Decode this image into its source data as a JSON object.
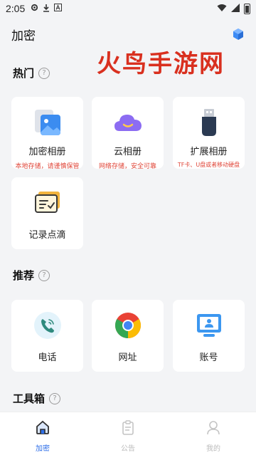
{
  "status_bar": {
    "time": "2:05"
  },
  "header": {
    "title": "加密"
  },
  "watermark": "火鸟手游网",
  "sections": {
    "hot": "热门",
    "recommend": "推荐",
    "tools": "工具箱",
    "help": "?"
  },
  "hot_cards": [
    {
      "label": "加密相册",
      "sub": "本地存储，请谨慎保管",
      "icon": "photo-album-icon"
    },
    {
      "label": "云相册",
      "sub": "网络存储，安全可靠",
      "icon": "cloud-icon"
    },
    {
      "label": "扩展相册",
      "sub": "TF卡、U盘或者移动硬盘",
      "icon": "usb-drive-icon"
    },
    {
      "label": "记录点滴",
      "icon": "notes-icon"
    }
  ],
  "recommend_cards": [
    {
      "label": "电话",
      "icon": "phone-icon"
    },
    {
      "label": "网址",
      "icon": "browser-icon"
    },
    {
      "label": "账号",
      "icon": "account-icon"
    }
  ],
  "bottom_nav": [
    {
      "label": "加密",
      "icon": "home-icon"
    },
    {
      "label": "公告",
      "icon": "notice-icon"
    },
    {
      "label": "我的",
      "icon": "profile-icon"
    }
  ],
  "colors": {
    "accent": "#2f6fe8",
    "watermark": "#d9301f",
    "sub_text": "#e0473a"
  }
}
